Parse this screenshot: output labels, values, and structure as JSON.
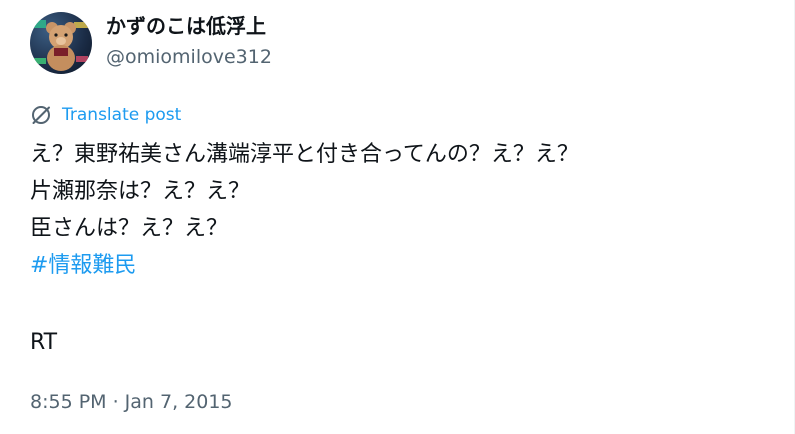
{
  "author": {
    "display_name": "かずのこは低浮上",
    "handle": "@omiomilove312",
    "avatar_icon": "teddy-bear-avatar-icon"
  },
  "translate": {
    "label": "Translate post",
    "icon": "translate-globe-icon"
  },
  "post": {
    "lines": [
      "え？東野祐美さん溝端淳平と付き合ってんの？え？え？",
      "片瀬那奈は？え？え？",
      "臣さんは？え？え？"
    ],
    "hashtag": "#情報難民",
    "footer": "RT"
  },
  "meta": {
    "timestamp": "8:55 PM · Jan 7, 2015"
  },
  "colors": {
    "text": "#0f1419",
    "secondary": "#536471",
    "link": "#1d9bf0"
  }
}
